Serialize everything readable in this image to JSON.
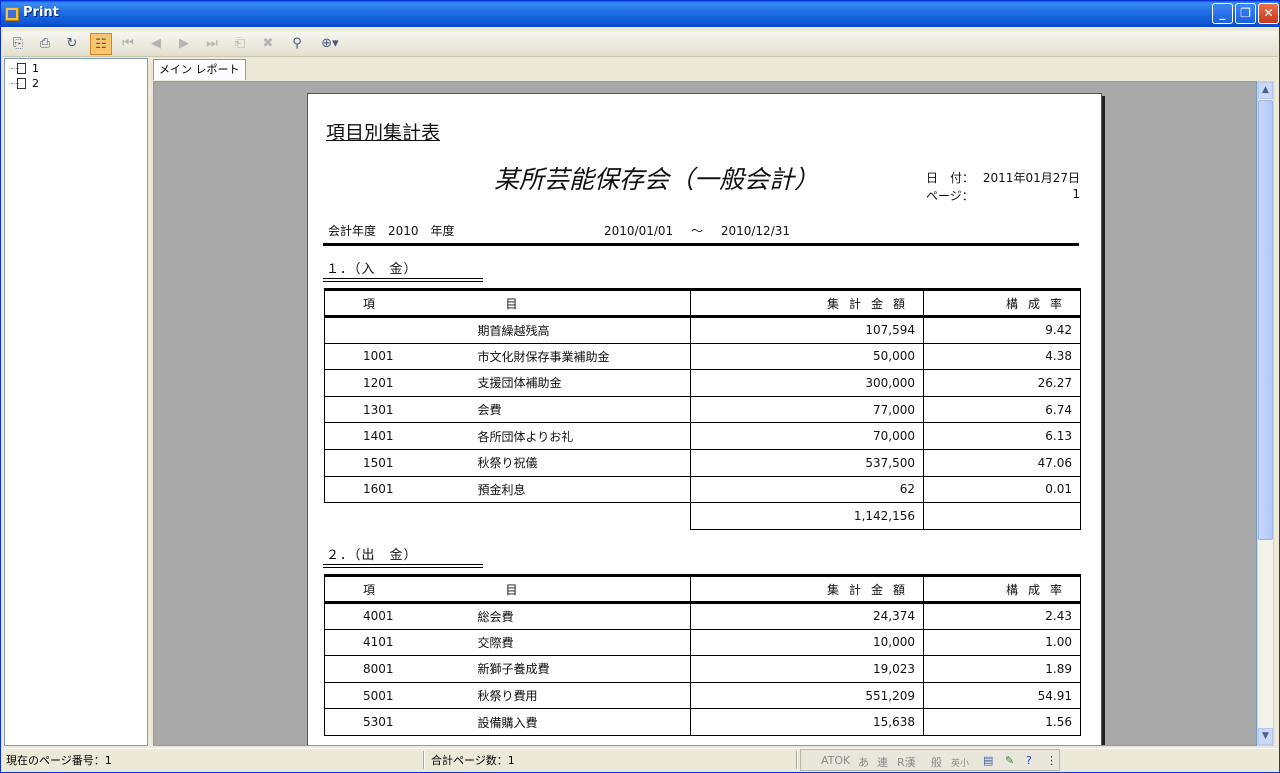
{
  "window": {
    "title": "Print",
    "tab_label": "メイン レポート"
  },
  "tree": {
    "items": [
      {
        "label": "1"
      },
      {
        "label": "2"
      }
    ]
  },
  "toolbar": {
    "icons": [
      "export-icon",
      "print-icon",
      "refresh-icon",
      "group-tree-icon",
      "first-page-icon",
      "prev-page-icon",
      "next-page-icon",
      "last-page-icon",
      "goto-page-icon",
      "stop-icon",
      "search-icon",
      "zoom-icon"
    ]
  },
  "report": {
    "title": "項目別集計表",
    "org": "某所芸能保存会（一般会計）",
    "date_label": "日　付：",
    "date_value": "2011年01月27日",
    "page_label": "ページ：",
    "page_value": "1",
    "fiscal_label": "会計年度　2010　年度",
    "period_from": "2010/01/01",
    "period_sep": "～",
    "period_to": "2010/12/31",
    "headers": {
      "code": "項",
      "name": "目",
      "amount": "集計金額",
      "rate": "構成率"
    },
    "income": {
      "title": "１．（入　金）",
      "rows": [
        {
          "code": "",
          "name": "期首繰越残高",
          "amount": "107,594",
          "rate": "9.42"
        },
        {
          "code": "1001",
          "name": "市文化財保存事業補助金",
          "amount": "50,000",
          "rate": "4.38"
        },
        {
          "code": "1201",
          "name": "支援団体補助金",
          "amount": "300,000",
          "rate": "26.27"
        },
        {
          "code": "1301",
          "name": "会費",
          "amount": "77,000",
          "rate": "6.74"
        },
        {
          "code": "1401",
          "name": "各所団体よりお礼",
          "amount": "70,000",
          "rate": "6.13"
        },
        {
          "code": "1501",
          "name": "秋祭り祝儀",
          "amount": "537,500",
          "rate": "47.06"
        },
        {
          "code": "1601",
          "name": "預金利息",
          "amount": "62",
          "rate": "0.01"
        }
      ],
      "total": "1,142,156"
    },
    "expense": {
      "title": "２．（出　金）",
      "rows": [
        {
          "code": "4001",
          "name": "総会費",
          "amount": "24,374",
          "rate": "2.43"
        },
        {
          "code": "4101",
          "name": "交際費",
          "amount": "10,000",
          "rate": "1.00"
        },
        {
          "code": "8001",
          "name": "新獅子養成費",
          "amount": "19,023",
          "rate": "1.89"
        },
        {
          "code": "5001",
          "name": "秋祭り費用",
          "amount": "551,209",
          "rate": "54.91"
        },
        {
          "code": "5301",
          "name": "設備購入費",
          "amount": "15,638",
          "rate": "1.56"
        }
      ]
    }
  },
  "status": {
    "current_page": "現在のページ番号：1",
    "total_pages": "合計ページ数：1",
    "ime": [
      "ATOK",
      "あ",
      "連",
      "R漢",
      "般",
      "英小"
    ]
  }
}
